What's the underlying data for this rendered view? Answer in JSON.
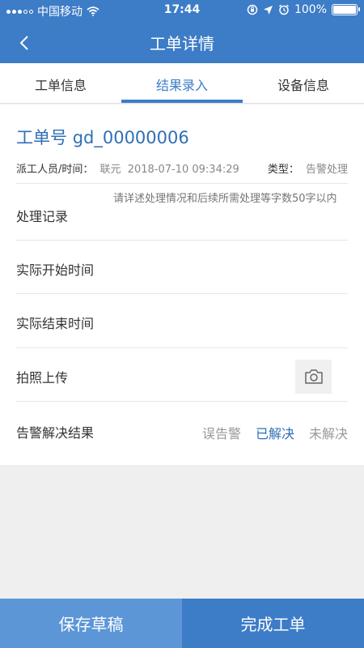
{
  "status_bar": {
    "carrier": "中国移动",
    "time": "17:44",
    "battery": "100%",
    "battery_level": 1.0
  },
  "header": {
    "title": "工单详情",
    "back_icon": "chevron-left-icon"
  },
  "tabs": [
    {
      "label": "工单信息",
      "active": false
    },
    {
      "label": "结果录入",
      "active": true
    },
    {
      "label": "设备信息",
      "active": false
    }
  ],
  "order": {
    "number_label": "工单号",
    "number": "gd_00000006",
    "dispatcher_label": "派工人员/时间：",
    "dispatcher": "联元",
    "dispatch_time": "2018-07-10 09:34:29",
    "type_label": "类型：",
    "type": "告警处理"
  },
  "form": {
    "record_label": "处理记录",
    "record_placeholder": "请详述处理情况和后续所需处理等字数50字以内",
    "start_time_label": "实际开始时间",
    "end_time_label": "实际结束时间",
    "photo_label": "拍照上传",
    "camera_icon": "camera-icon",
    "result_label": "告警解决结果",
    "result_options": [
      "误告警",
      "已解决",
      "未解决"
    ],
    "result_selected": "已解决"
  },
  "actions": {
    "save_draft": "保存草稿",
    "complete": "完成工单"
  },
  "colors": {
    "primary": "#3d7cc7",
    "secondary_button": "#5c96d6",
    "accent_text": "#2f6fb6"
  }
}
